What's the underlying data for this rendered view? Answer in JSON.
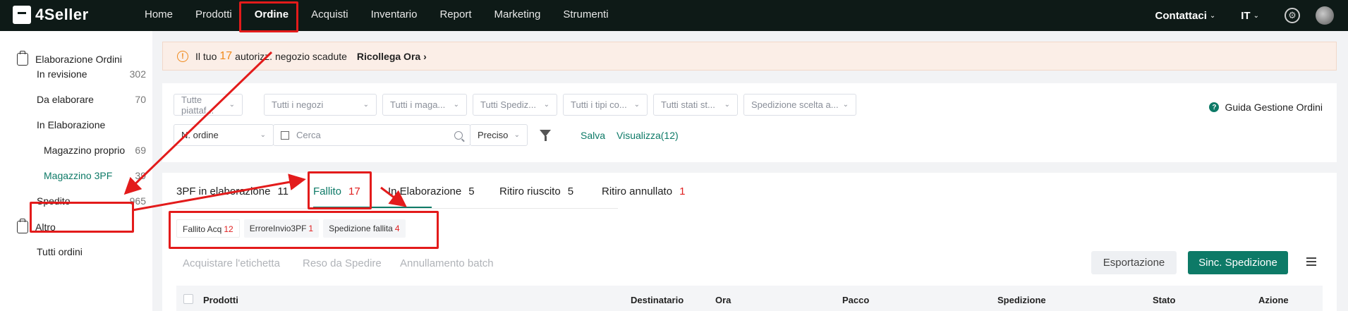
{
  "app": {
    "name": "4Seller"
  },
  "nav": {
    "items": [
      "Home",
      "Prodotti",
      "Ordine",
      "Acquisti",
      "Inventario",
      "Report",
      "Marketing",
      "Strumenti"
    ],
    "active": "Ordine",
    "contact": "Contattaci",
    "language": "IT"
  },
  "sidebar": {
    "group1": "Elaborazione Ordini",
    "items": [
      {
        "label": "In revisione",
        "count": "302"
      },
      {
        "label": "Da elaborare",
        "count": "70"
      },
      {
        "label": "In Elaborazione",
        "count": ""
      },
      {
        "label": "Magazzino proprio",
        "count": "69"
      },
      {
        "label": "Magazzino 3PF",
        "count": "39"
      },
      {
        "label": "Spedito",
        "count": "965"
      }
    ],
    "group2": "Altro",
    "more": "Tutti ordini"
  },
  "alert": {
    "prefix": "Il tuo",
    "count": "17",
    "suffix": "autorizz. negozio scadute",
    "link": "Ricollega Ora"
  },
  "filters": {
    "row1": [
      "Tutte piattaf...",
      "Tutti i negozi",
      "Tutti i maga...",
      "Tutti Spediz...",
      "Tutti i tipi co...",
      "Tutti stati st...",
      "Spedizione scelta a..."
    ],
    "order_field": "N. ordine",
    "search_placeholder": "Cerca",
    "match": "Preciso",
    "save": "Salva",
    "view": "Visualizza(12)",
    "guide": "Guida Gestione Ordini"
  },
  "tabs": [
    {
      "label": "3PF in elaborazione",
      "count": "11"
    },
    {
      "label": "Fallito",
      "count": "17"
    },
    {
      "label": "In Elaborazione",
      "count": "5"
    },
    {
      "label": "Ritiro riuscito",
      "count": "5"
    },
    {
      "label": "Ritiro annullato",
      "count": "1"
    }
  ],
  "subtabs": [
    {
      "label": "Fallito Acq",
      "count": "12"
    },
    {
      "label": "ErroreInvio3PF",
      "count": "1"
    },
    {
      "label": "Spedizione fallita",
      "count": "4"
    }
  ],
  "actions": {
    "buy_label": "Acquistare l'etichetta",
    "return": "Reso da Spedire",
    "cancel_batch": "Annullamento batch",
    "export": "Esportazione",
    "sync": "Sinc. Spedizione"
  },
  "table": {
    "columns": [
      "Prodotti",
      "Destinatario",
      "Ora",
      "Pacco",
      "Spedizione",
      "Stato",
      "Azione"
    ]
  },
  "colors": {
    "accent": "#0d7a67",
    "alert_bg": "#fbeee7",
    "warning": "#f08a1c",
    "count_red": "#e02020",
    "annotation": "#e31b1b"
  }
}
